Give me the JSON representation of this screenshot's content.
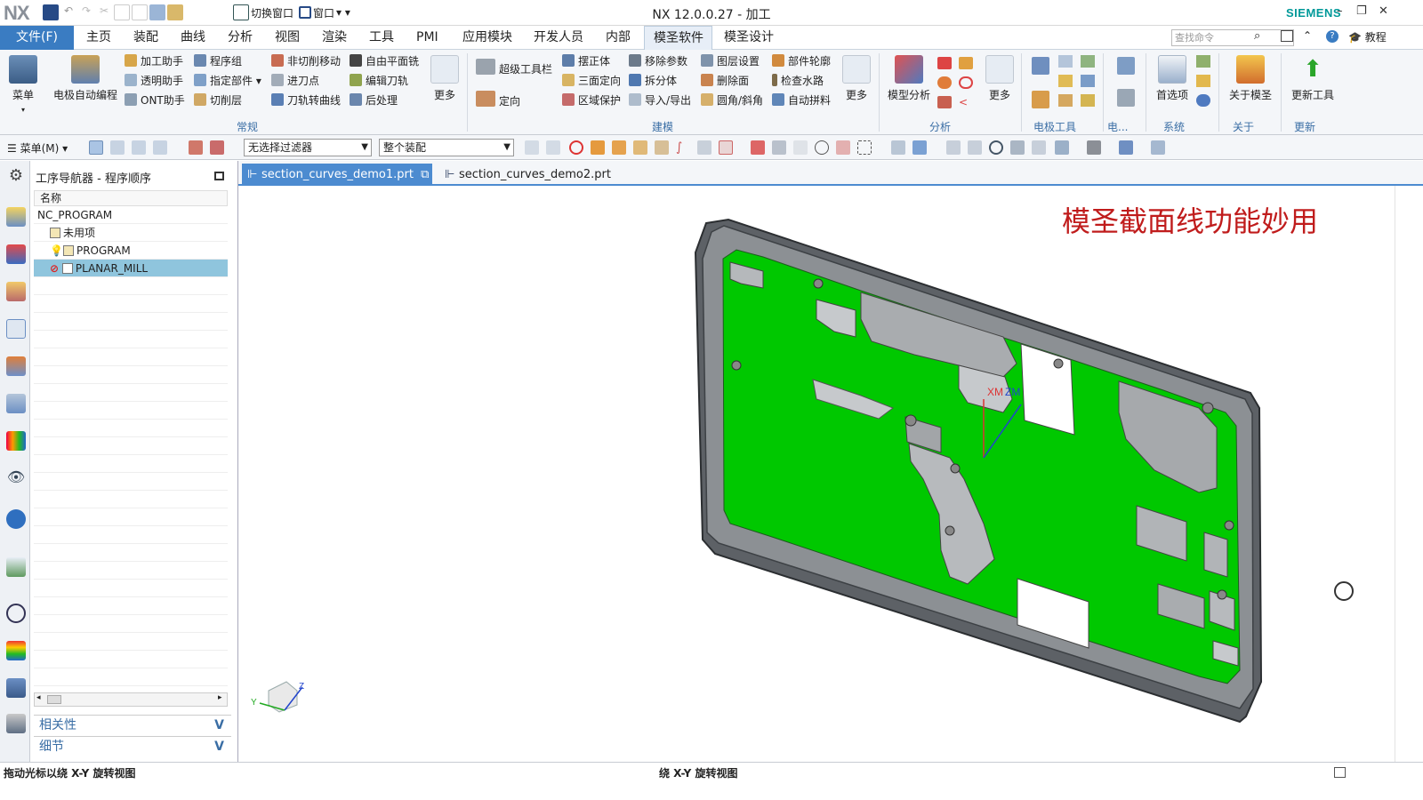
{
  "app": {
    "logo": "NX",
    "title": "NX 12.0.0.27 - 加工",
    "brand": "SIEMENS",
    "quick_access": {
      "switch_window": "切换窗口",
      "window": "窗口"
    }
  },
  "menu": {
    "file": "文件(F)",
    "tabs": [
      "主页",
      "装配",
      "曲线",
      "分析",
      "视图",
      "渲染",
      "工具",
      "PMI",
      "应用模块",
      "开发人员",
      "内部",
      "模圣软件",
      "模圣设计"
    ],
    "active_tab": "模圣软件",
    "search_placeholder": "查找命令",
    "tutorial": "教程"
  },
  "ribbon": {
    "menu_btn": "菜单",
    "electrode_auto": "电极自动编程",
    "g1": [
      "加工助手",
      "透明助手",
      "ONT助手"
    ],
    "g2": [
      "程序组",
      "指定部件",
      "切削层"
    ],
    "g3": [
      "非切削移动",
      "进刀点",
      "刀轨转曲线"
    ],
    "g4": [
      "自由平面铣",
      "编辑刀轨",
      "后处理"
    ],
    "more": "更多",
    "group_common": "常规",
    "super_toolbar": "超级工具栏",
    "orient": "定向",
    "g5": [
      "摆正体",
      "三面定向",
      "区域保护"
    ],
    "g6": [
      "移除参数",
      "拆分体",
      "导入/导出"
    ],
    "g7": [
      "图层设置",
      "删除面",
      "圆角/斜角"
    ],
    "g8": [
      "部件轮廓",
      "检查水路",
      "自动拼料"
    ],
    "group_model": "建模",
    "model_analysis": "模型分析",
    "group_analysis": "分析",
    "group_electrode": "电极工具",
    "group_elec2": "电...",
    "preferences": "首选项",
    "group_system": "系统",
    "about": "关于模圣",
    "group_about": "关于",
    "update_tools": "更新工具",
    "group_update": "更新"
  },
  "toolbar": {
    "menu": "菜单(M)",
    "filter": "无选择过滤器",
    "scope": "整个装配"
  },
  "navigator": {
    "title": "工序导航器 - 程序顺序",
    "column": "名称",
    "rows": [
      "NC_PROGRAM",
      "未用项",
      "PROGRAM",
      "PLANAR_MILL"
    ],
    "relevance": "相关性",
    "details": "细节"
  },
  "docs": {
    "tab1": "section_curves_demo1.prt",
    "tab2": "section_curves_demo2.prt"
  },
  "viewport": {
    "overlay_title": "模圣截面线功能妙用",
    "axis_xm": "XM",
    "axis_zm": "ZM",
    "triad_y": "Y",
    "triad_z": "Z"
  },
  "status": {
    "left": "拖动光标以绕 X-Y 旋转视图",
    "center": "绕 X-Y 旋转视图"
  },
  "colors": {
    "accent": "#3a7cc2",
    "part_green": "#00c800",
    "brand": "#009999",
    "overlay_red": "#c01c1c"
  }
}
